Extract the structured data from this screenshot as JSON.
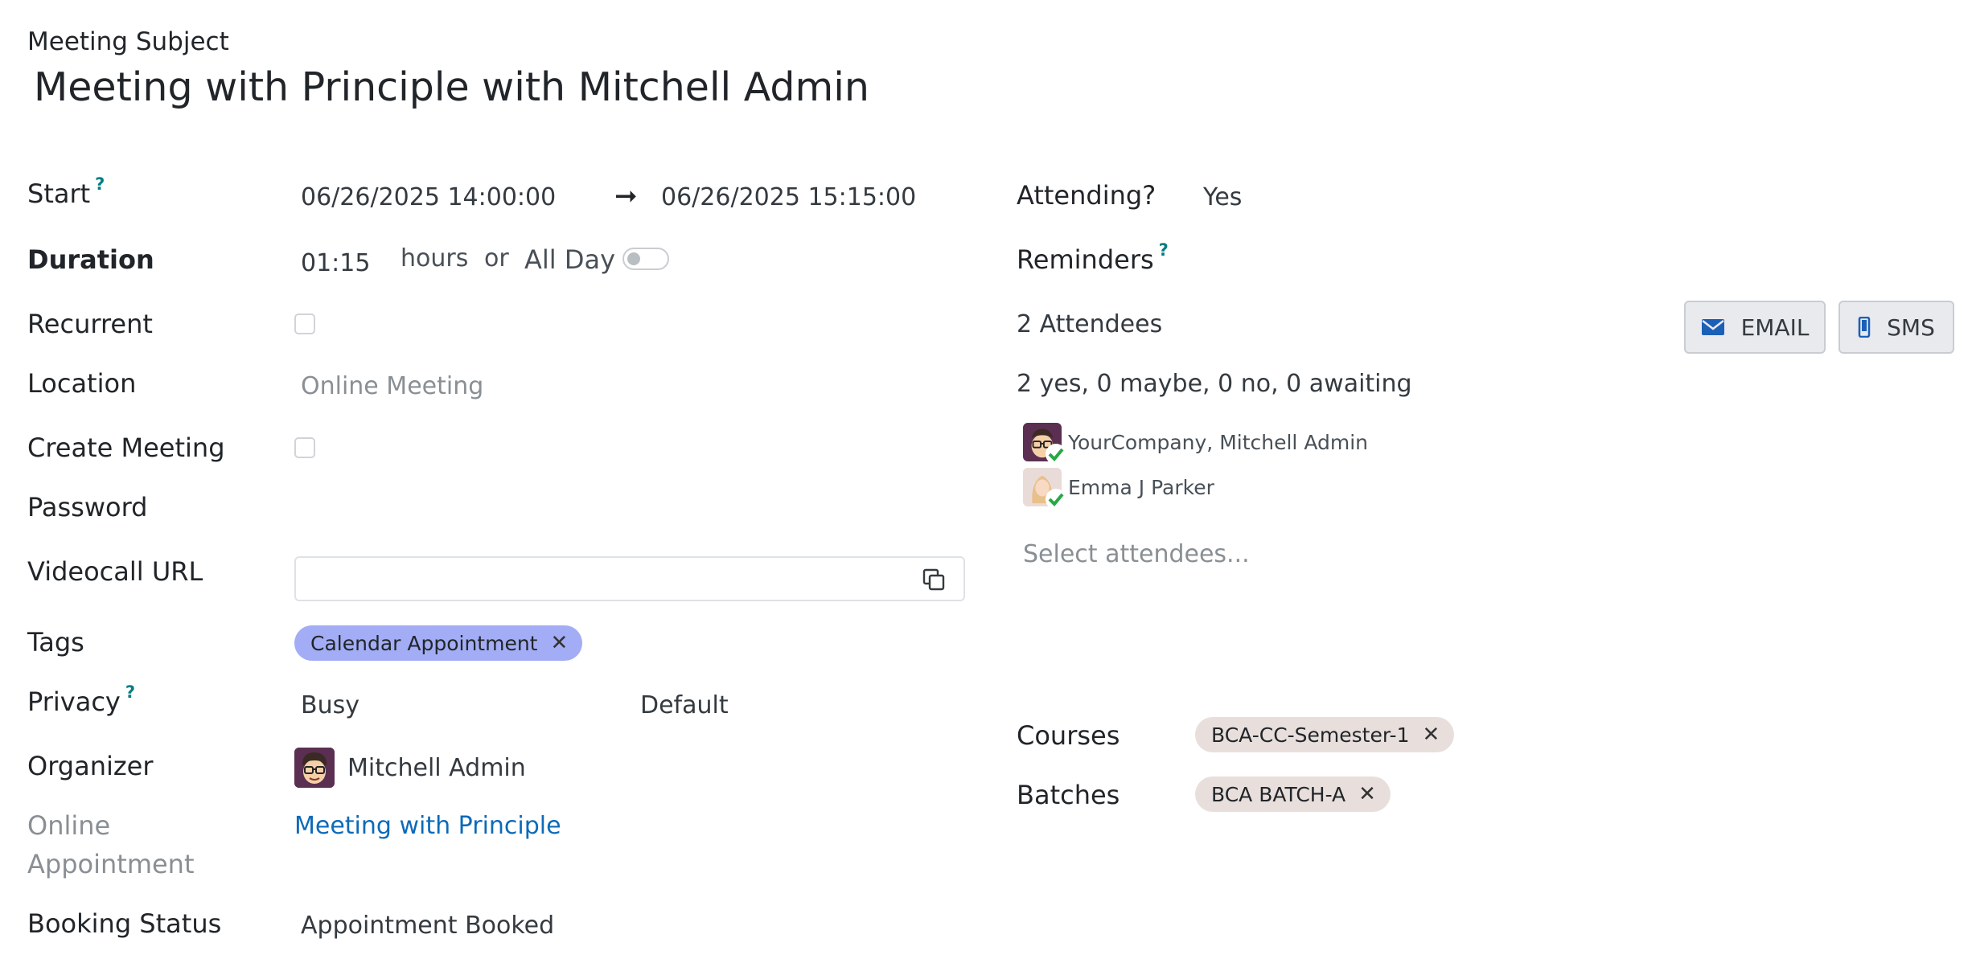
{
  "header": {
    "field_label": "Meeting Subject",
    "title": "Meeting with Principle with Mitchell Admin"
  },
  "form_left": {
    "start": {
      "label": "Start",
      "help": "?",
      "start_value": "06/26/2025 14:00:00",
      "arrow": "➞",
      "end_value": "06/26/2025 15:15:00"
    },
    "duration": {
      "label": "Duration",
      "value": "01:15",
      "unit": "hours",
      "or_text": "or",
      "allday_label": "All Day",
      "allday_on": false
    },
    "recurrent": {
      "label": "Recurrent",
      "checked": false
    },
    "location": {
      "label": "Location",
      "placeholder": "Online Meeting"
    },
    "create_meeting": {
      "label": "Create Meeting",
      "checked": false
    },
    "password": {
      "label": "Password",
      "value": ""
    },
    "videocall": {
      "label": "Videocall URL",
      "value": ""
    },
    "tags": {
      "label": "Tags",
      "items": [
        "Calendar Appointment"
      ]
    },
    "privacy": {
      "label": "Privacy",
      "help": "?",
      "show_as": "Busy",
      "privacy_value": "Default"
    },
    "organizer": {
      "label": "Organizer",
      "name": "Mitchell Admin"
    },
    "online_appointment": {
      "label_line1": "Online",
      "label_line2": "Appointment",
      "link": "Meeting with Principle"
    },
    "booking_status": {
      "label": "Booking Status",
      "value": "Appointment Booked"
    }
  },
  "form_right": {
    "attending": {
      "label": "Attending?",
      "value": "Yes"
    },
    "reminders": {
      "label": "Reminders",
      "help": "?"
    },
    "attendees": {
      "count_label": "2 Attendees",
      "summary": "2 yes, 0 maybe, 0 no, 0 awaiting",
      "list": [
        {
          "name": "YourCompany, Mitchell Admin"
        },
        {
          "name": "Emma J Parker"
        }
      ],
      "select_placeholder": "Select attendees..."
    },
    "buttons": {
      "email": "EMAIL",
      "sms": "SMS"
    },
    "courses": {
      "label": "Courses",
      "items": [
        "BCA-CC-Semester-1"
      ]
    },
    "batches": {
      "label": "Batches",
      "items": [
        "BCA BATCH-A"
      ]
    }
  },
  "colors": {
    "tag_calendar_bg": "#a3adf5",
    "tag_course_bg": "#e8dfdc",
    "link": "#0d6ab8",
    "help": "#017e84",
    "check_green": "#28a745",
    "email_icon": "#1b5fb7",
    "sms_icon": "#1b5fb7"
  }
}
